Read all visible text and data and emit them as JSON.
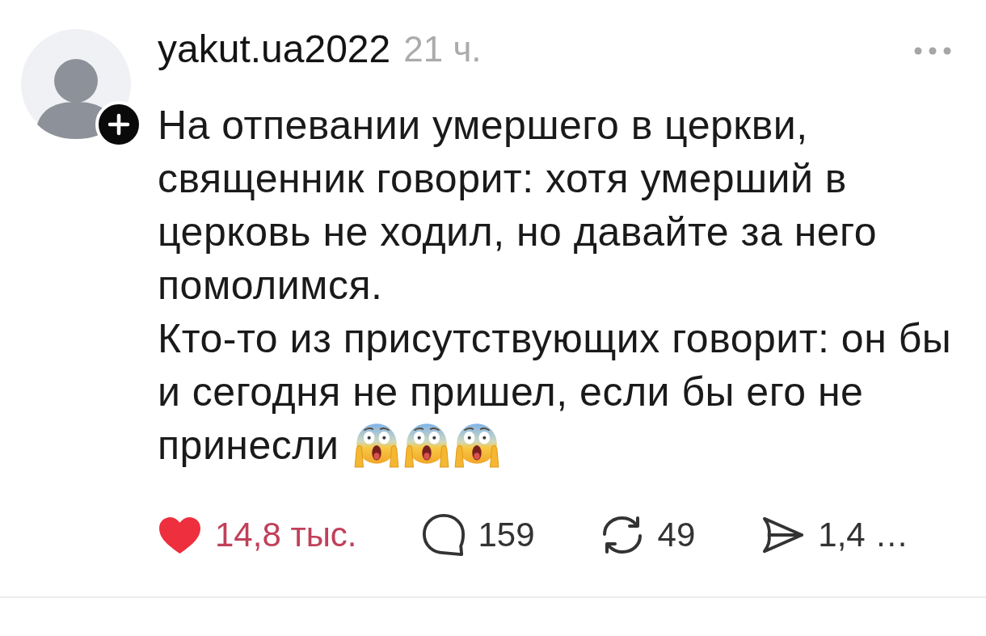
{
  "post": {
    "author": "yakut.ua2022",
    "time": "21 ч.",
    "paragraphs": [
      {
        "lines": [
          "На отпевании умершего в церкви,",
          "священник говорит: хотя умерший в",
          "церковь не ходил, но давайте за него",
          "помолимся."
        ]
      },
      {
        "lines": [
          "Кто-то из присутствующих говорит: он бы",
          "и сегодня не пришел, если бы его не",
          "принесли"
        ]
      }
    ],
    "emojis": [
      {
        "kind": "scream"
      },
      {
        "kind": "scream"
      },
      {
        "kind": "scream"
      }
    ],
    "actions": [
      {
        "kind": "like",
        "count": "14,8 тыс.",
        "selected": true
      },
      {
        "kind": "comment",
        "count": "159"
      },
      {
        "kind": "repost",
        "count": "49"
      },
      {
        "kind": "share",
        "count": "1,4 …"
      }
    ]
  }
}
